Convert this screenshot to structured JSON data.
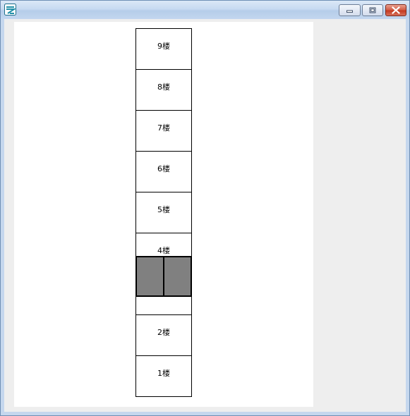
{
  "window": {
    "title": "",
    "app_icon": "app-icon",
    "controls": {
      "minimize_icon": "minimize-icon",
      "maximize_icon": "maximize-icon",
      "close_icon": "close-icon"
    }
  },
  "building": {
    "floors": [
      {
        "label": "9楼"
      },
      {
        "label": "8楼"
      },
      {
        "label": "7楼"
      },
      {
        "label": "6楼"
      },
      {
        "label": "5楼"
      },
      {
        "label": "4楼"
      },
      {
        "label": ""
      },
      {
        "label": "2楼"
      },
      {
        "label": "1楼"
      }
    ],
    "elevator": {
      "current_floor": 3,
      "door_color": "#808080"
    }
  }
}
